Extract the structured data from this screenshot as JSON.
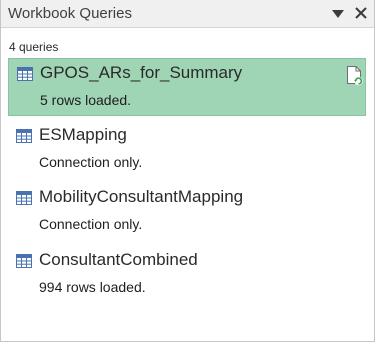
{
  "pane": {
    "title": "Workbook Queries",
    "options_icon": "dropdown-triangle-icon",
    "close_icon": "close-icon",
    "query_count": "4 queries"
  },
  "queries": [
    {
      "name": "GPOS_ARs_for_Summary",
      "status": "5 rows loaded.",
      "selected": true,
      "icon": "table-icon",
      "action_icon": "refresh-document-icon"
    },
    {
      "name": "ESMapping",
      "status": "Connection only.",
      "selected": false,
      "icon": "table-icon"
    },
    {
      "name": "MobilityConsultantMapping",
      "status": "Connection only.",
      "selected": false,
      "icon": "table-icon"
    },
    {
      "name": "ConsultantCombined",
      "status": "994 rows loaded.",
      "selected": false,
      "icon": "table-icon"
    }
  ],
  "colors": {
    "selected_background": "#9fd5b5",
    "selected_border": "#86c59f",
    "table_icon": "#4a72b0"
  }
}
